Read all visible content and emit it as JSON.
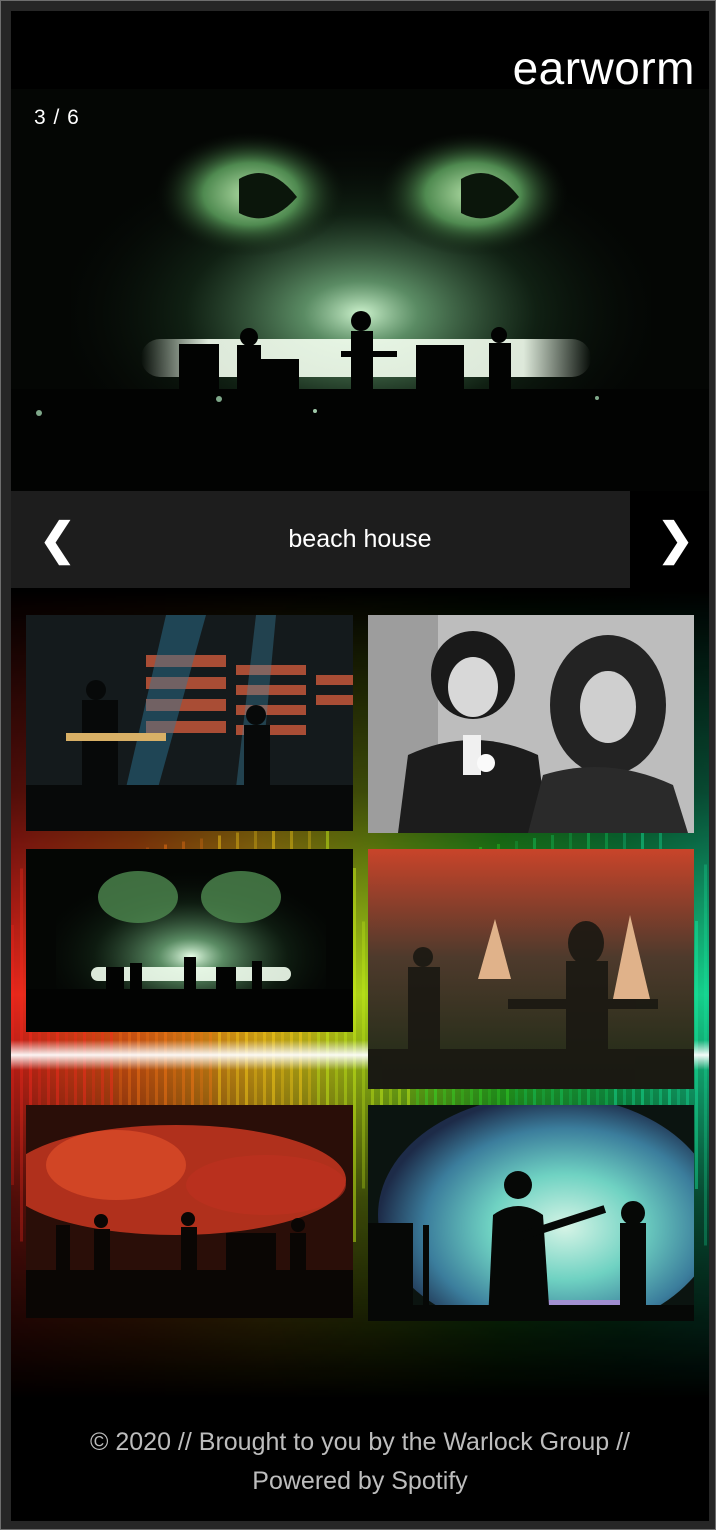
{
  "header": {
    "brand": "earworm"
  },
  "slideshow": {
    "counter": "3 / 6",
    "caption": "beach house",
    "prev_icon": "chevron-left-icon",
    "next_icon": "chevron-right-icon",
    "prev_glyph": "❮",
    "next_glyph": "❯"
  },
  "gallery": {
    "photos": [
      {
        "name": "photo-stage-striped-lights",
        "accent": "#d9572f"
      },
      {
        "name": "photo-band-portrait-bw",
        "accent": "#9a9a9a"
      },
      {
        "name": "photo-stage-eyes-green",
        "accent": "#8ec99a"
      },
      {
        "name": "photo-stage-red-triangles",
        "accent": "#c9442a"
      },
      {
        "name": "photo-stage-red-smoke",
        "accent": "#e0462a"
      },
      {
        "name": "photo-stage-spotlight-silhouette",
        "accent": "#7fd6c6"
      }
    ]
  },
  "visualizer": {
    "colors": [
      "#ff2a1f",
      "#ff7a16",
      "#ffd21a",
      "#c9f01a",
      "#35e02a",
      "#14d064",
      "#19e8a0"
    ]
  },
  "footer": {
    "line1": "© 2020 // Brought to you by the Warlock Group //",
    "line2": "Powered by Spotify"
  }
}
